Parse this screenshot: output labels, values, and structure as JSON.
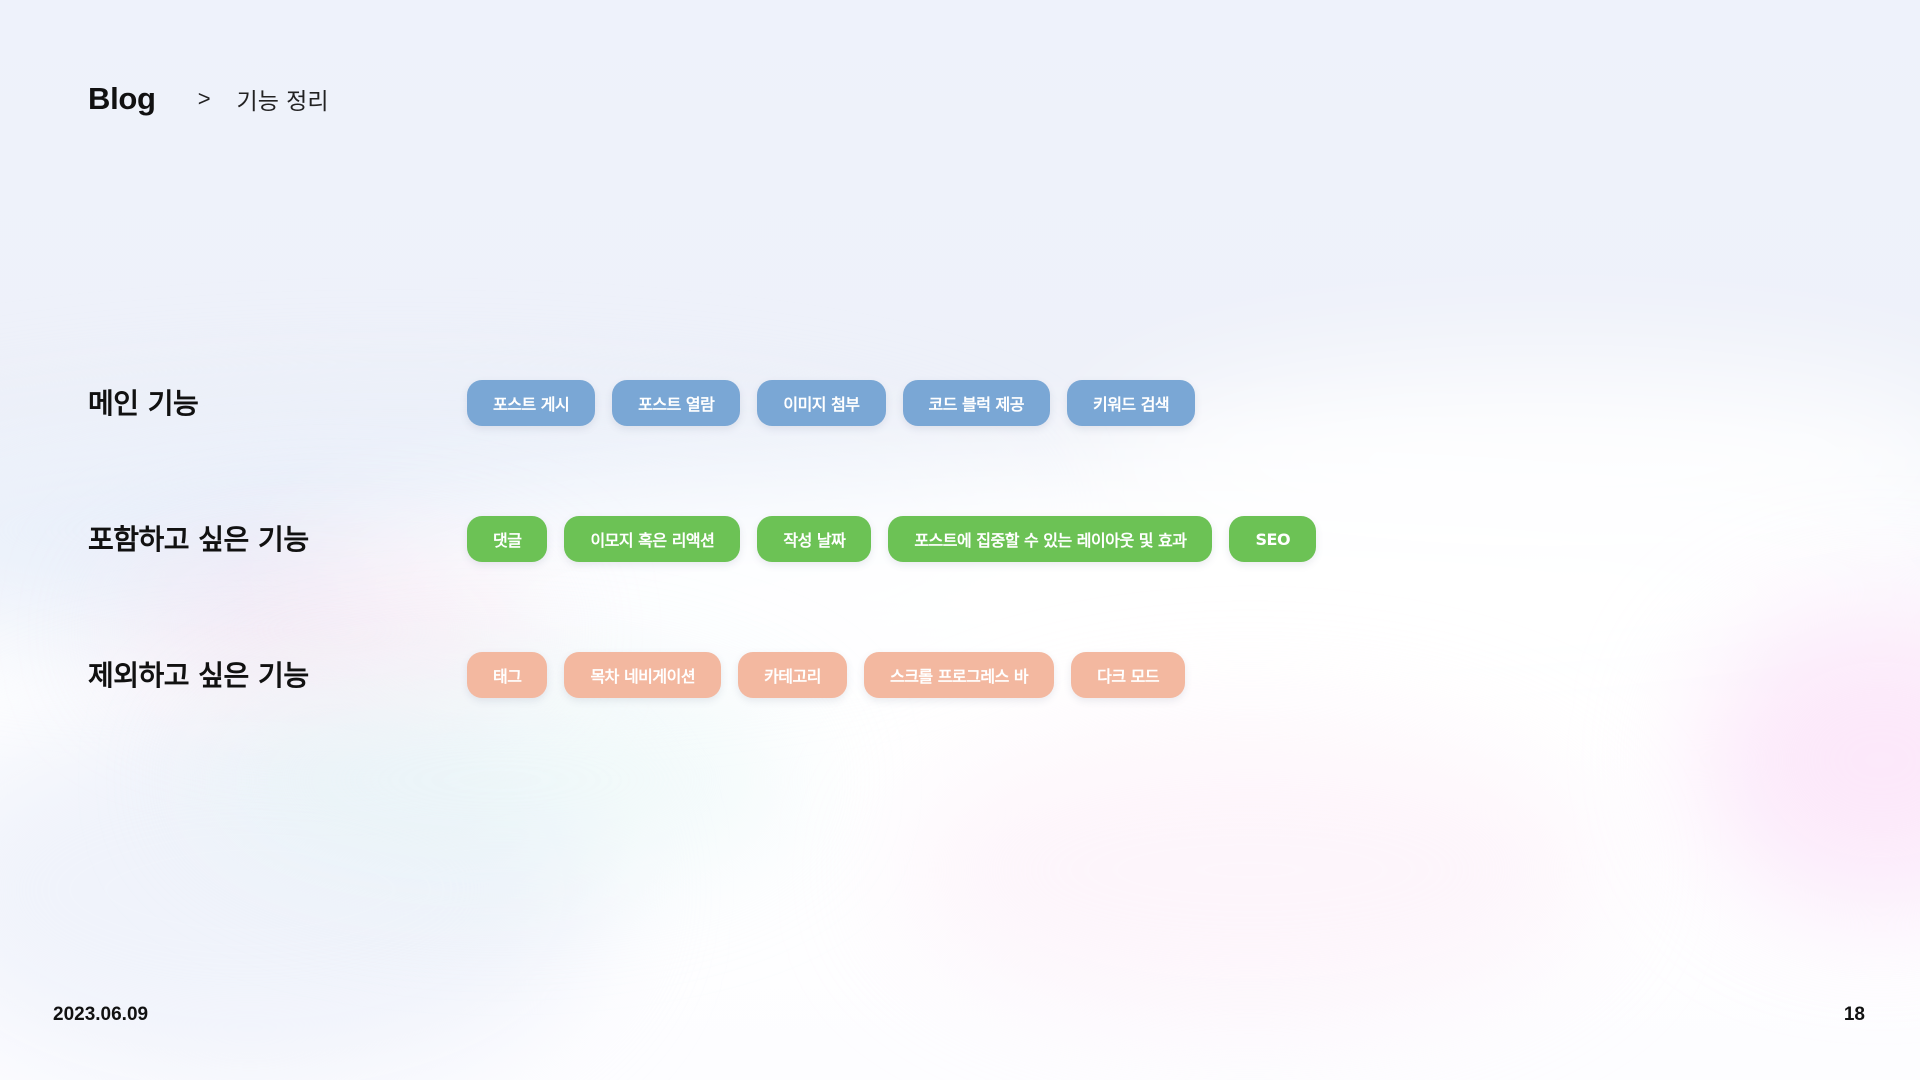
{
  "breadcrumb": {
    "root": "Blog",
    "separator": ">",
    "current": "기능 정리"
  },
  "sections": [
    {
      "title": "메인 기능",
      "color": "#7aa7d5",
      "tags": [
        "포스트 게시",
        "포스트 열람",
        "이미지 첨부",
        "코드 블럭 제공",
        "키워드 검색"
      ]
    },
    {
      "title": "포함하고 싶은 기능",
      "color": "#6cc255",
      "tags": [
        "댓글",
        "이모지 혹은 리액션",
        "작성 날짜",
        "포스트에 집중할 수 있는 레이아웃 및 효과",
        "SEO"
      ]
    },
    {
      "title": "제외하고 싶은 기능",
      "color": "#f3b8a0",
      "tags": [
        "태그",
        "목차 네비게이션",
        "카테고리",
        "스크롤 프로그레스 바",
        "다크 모드"
      ]
    }
  ],
  "footer": {
    "date": "2023.06.09",
    "page": "18"
  }
}
